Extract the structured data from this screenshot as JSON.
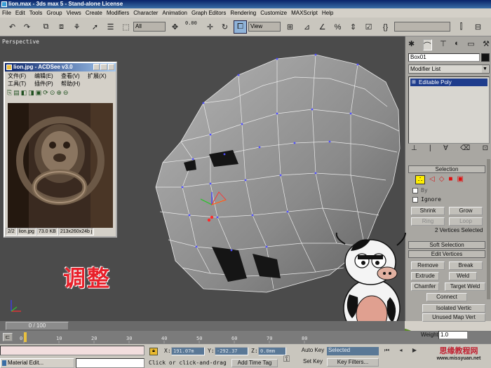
{
  "window": {
    "title": "lion.max - 3ds max 5 - Stand-alone License"
  },
  "menu": [
    "File",
    "Edit",
    "Tools",
    "Group",
    "Views",
    "Create",
    "Modifiers",
    "Character",
    "Animation",
    "Graph Editors",
    "Rendering",
    "Customize",
    "MAXScript",
    "Help"
  ],
  "toolbar": {
    "selection_filter": "All",
    "coord_system": "View",
    "spinner_value": "0.00",
    "spinner_value2": "0.00",
    "named_selection": ""
  },
  "viewport": {
    "label": "Perspective",
    "overlay_text": "调整"
  },
  "acdsee": {
    "title": "lion.jpg - ACDSee v3.0",
    "menu": [
      "文件(F)",
      "编辑(E)",
      "查看(V)",
      "扩展(X)",
      "工具(T)",
      "插件(P)",
      "帮助(H)"
    ],
    "status": {
      "index": "2/2",
      "filename": "lion.jpg",
      "size": "73.0 KB",
      "dims": "213x260x24b j"
    }
  },
  "command_panel": {
    "object_name": "Box01",
    "modifier_list": "Modifier List",
    "stack_item": "Editable Poly",
    "selection_rollout": "Selection",
    "by_vertex": "By",
    "ignore_backfacing": "Ignore",
    "shrink": "Shrink",
    "grow": "Grow",
    "ring": "Ring",
    "loop": "Loop",
    "selection_status": "2 Vertices Selected",
    "soft_selection": "Soft Selection",
    "edit_vertices": "Edit Vertices",
    "remove": "Remove",
    "break": "Break",
    "extrude": "Extrude",
    "weld": "Weld",
    "chamfer": "Chamfer",
    "target_weld": "Target Weld",
    "connect": "Connect",
    "remove_isolated": "Isolated Vertic",
    "remove_unused": "Unused Map Vert",
    "weight_label": "Weight:",
    "weight_value": "1.0"
  },
  "timeline": {
    "slider": "0 / 100",
    "ticks": [
      "0",
      "10",
      "20",
      "30",
      "40",
      "50",
      "60",
      "70",
      "80"
    ]
  },
  "status": {
    "x_label": "X:",
    "x_value": "191.07m",
    "y_label": "Y:",
    "y_value": "-292.37",
    "z_label": "Z:",
    "z_value": "0.0mm",
    "auto_key": "Auto Key",
    "selected": "Selected",
    "set_key": "Set Key",
    "key_filters": "Key Filters...",
    "prompt": "Click or click-and-drag",
    "add_time_tag": "Add Time Tag",
    "taskbar_item": "Material Edit..."
  },
  "watermark": {
    "site_cn": "思缘教程网",
    "site_url": "www.missyuan.net"
  },
  "colors": {
    "viewport_bg": "#4b4b4b",
    "mesh_fill": "#8a8a8a",
    "vertex": "#5050ff",
    "overlay_red": "#e8202a",
    "coord_field": "#5a7896"
  }
}
